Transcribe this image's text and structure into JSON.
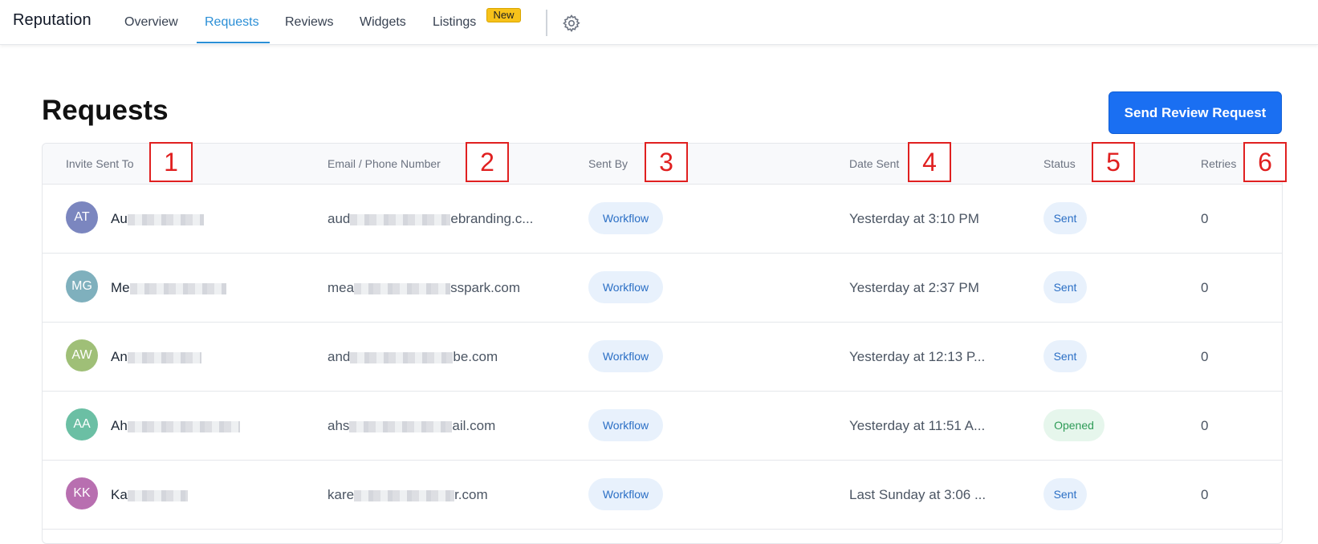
{
  "nav": {
    "brand": "Reputation",
    "tabs": [
      {
        "label": "Overview"
      },
      {
        "label": "Requests"
      },
      {
        "label": "Reviews"
      },
      {
        "label": "Widgets"
      },
      {
        "label": "Listings"
      }
    ],
    "active_tab": "Requests",
    "new_badge": "New",
    "settings_icon": "gear-icon"
  },
  "page": {
    "title": "Requests",
    "send_button": "Send Review Request"
  },
  "table": {
    "columns": [
      "Invite Sent To",
      "Email / Phone Number",
      "Sent By",
      "Date Sent",
      "Status",
      "Retries"
    ],
    "rows": [
      {
        "initials": "AT",
        "avatar_color": "#7b86bf",
        "name": "Au",
        "email_start": "aud",
        "email_end": "ebranding.c...",
        "sent_by": "Workflow",
        "date": "Yesterday at 3:10 PM",
        "status": "Sent",
        "retries": "0"
      },
      {
        "initials": "MG",
        "avatar_color": "#7fb0bd",
        "name": "Me",
        "email_start": "mea",
        "email_end": "sspark.com",
        "sent_by": "Workflow",
        "date": "Yesterday at 2:37 PM",
        "status": "Sent",
        "retries": "0"
      },
      {
        "initials": "AW",
        "avatar_color": "#9fbf77",
        "name": "An",
        "email_start": "and",
        "email_end": "be.com",
        "sent_by": "Workflow",
        "date": "Yesterday at 12:13 P...",
        "status": "Sent",
        "retries": "0"
      },
      {
        "initials": "AA",
        "avatar_color": "#6bbfa4",
        "name": "Ah",
        "email_start": "ahs",
        "email_end": "ail.com",
        "sent_by": "Workflow",
        "date": "Yesterday at 11:51 A...",
        "status": "Opened",
        "retries": "0"
      },
      {
        "initials": "KK",
        "avatar_color": "#b86fb0",
        "name": "Ka",
        "email_start": "kare",
        "email_end": "r.com",
        "sent_by": "Workflow",
        "date": "Last Sunday at 3:06 ...",
        "status": "Sent",
        "retries": "0"
      }
    ]
  },
  "markers": [
    "1",
    "2",
    "3",
    "4",
    "5",
    "6"
  ],
  "colors": {
    "accent": "#2b8fd6",
    "primary_button": "#1a6ff2",
    "badge": "#f7c21a",
    "marker": "#e02020"
  }
}
